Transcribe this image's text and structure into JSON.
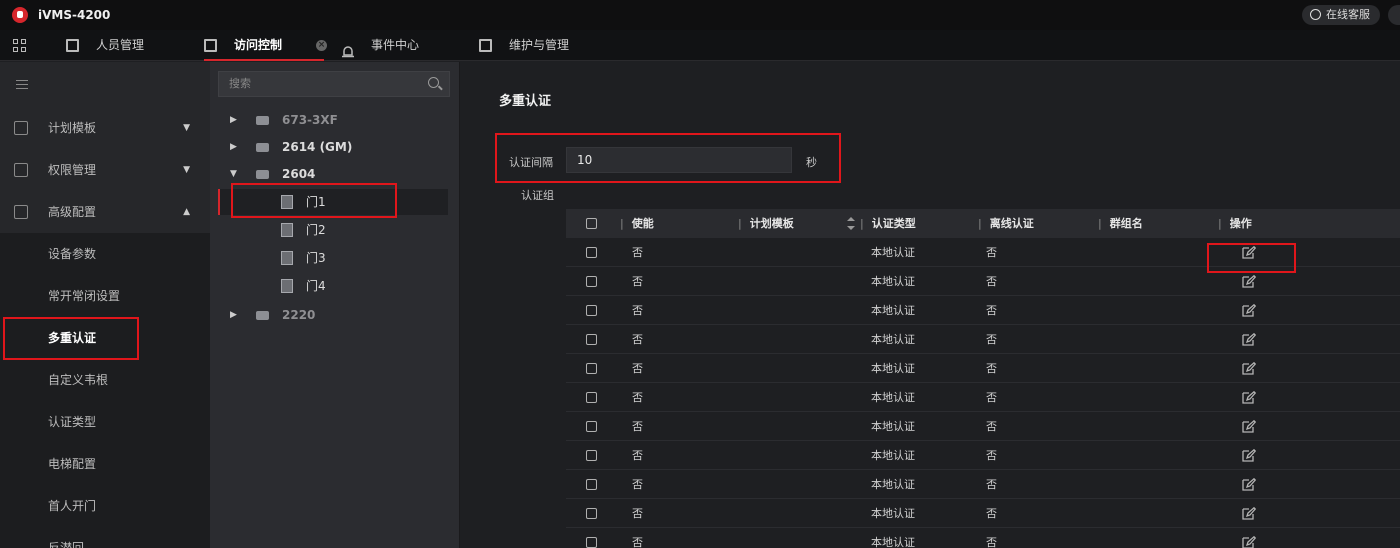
{
  "app": {
    "title": "iVMS-4200",
    "support_label": "在线客服"
  },
  "tabs": [
    {
      "label": "人员管理",
      "active": false
    },
    {
      "label": "访问控制",
      "active": true
    },
    {
      "label": "事件中心",
      "active": false
    },
    {
      "label": "维护与管理",
      "active": false
    }
  ],
  "sidebar": {
    "items": [
      {
        "label": "计划模板",
        "caret": "▼"
      },
      {
        "label": "权限管理",
        "caret": "▼"
      },
      {
        "label": "高级配置",
        "caret": "▲"
      },
      {
        "label": "设备参数"
      },
      {
        "label": "常开常闭设置"
      },
      {
        "label": "多重认证"
      },
      {
        "label": "自定义韦根"
      },
      {
        "label": "认证类型"
      },
      {
        "label": "电梯配置"
      },
      {
        "label": "首人开门"
      },
      {
        "label": "反潜回"
      }
    ]
  },
  "tree": {
    "search_placeholder": "搜索",
    "nodes": [
      {
        "label": "673-3XF",
        "arrow": "▶"
      },
      {
        "label": "2614 (GM)",
        "arrow": "▶"
      },
      {
        "label": "2604",
        "arrow": "▼"
      },
      {
        "label": "门1"
      },
      {
        "label": "门2"
      },
      {
        "label": "门3"
      },
      {
        "label": "门4"
      },
      {
        "label": "2220",
        "arrow": "▶"
      }
    ]
  },
  "main": {
    "title": "多重认证",
    "interval_label": "认证间隔",
    "interval_value": "10",
    "interval_unit": "秒",
    "group_label": "认证组",
    "columns": [
      "使能",
      "计划模板",
      "认证类型",
      "离线认证",
      "群组名",
      "操作"
    ],
    "column_sep": "|",
    "rows": [
      {
        "enabled": "否",
        "template": "",
        "auth_type": "本地认证",
        "offline": "否",
        "group": ""
      },
      {
        "enabled": "否",
        "template": "",
        "auth_type": "本地认证",
        "offline": "否",
        "group": ""
      },
      {
        "enabled": "否",
        "template": "",
        "auth_type": "本地认证",
        "offline": "否",
        "group": ""
      },
      {
        "enabled": "否",
        "template": "",
        "auth_type": "本地认证",
        "offline": "否",
        "group": ""
      },
      {
        "enabled": "否",
        "template": "",
        "auth_type": "本地认证",
        "offline": "否",
        "group": ""
      },
      {
        "enabled": "否",
        "template": "",
        "auth_type": "本地认证",
        "offline": "否",
        "group": ""
      },
      {
        "enabled": "否",
        "template": "",
        "auth_type": "本地认证",
        "offline": "否",
        "group": ""
      },
      {
        "enabled": "否",
        "template": "",
        "auth_type": "本地认证",
        "offline": "否",
        "group": ""
      },
      {
        "enabled": "否",
        "template": "",
        "auth_type": "本地认证",
        "offline": "否",
        "group": ""
      },
      {
        "enabled": "否",
        "template": "",
        "auth_type": "本地认证",
        "offline": "否",
        "group": ""
      },
      {
        "enabled": "否",
        "template": "",
        "auth_type": "本地认证",
        "offline": "否",
        "group": ""
      }
    ]
  },
  "colors": {
    "accent": "#d6262c",
    "highlight_box": "#e0161b",
    "background": "#1e1f22"
  }
}
